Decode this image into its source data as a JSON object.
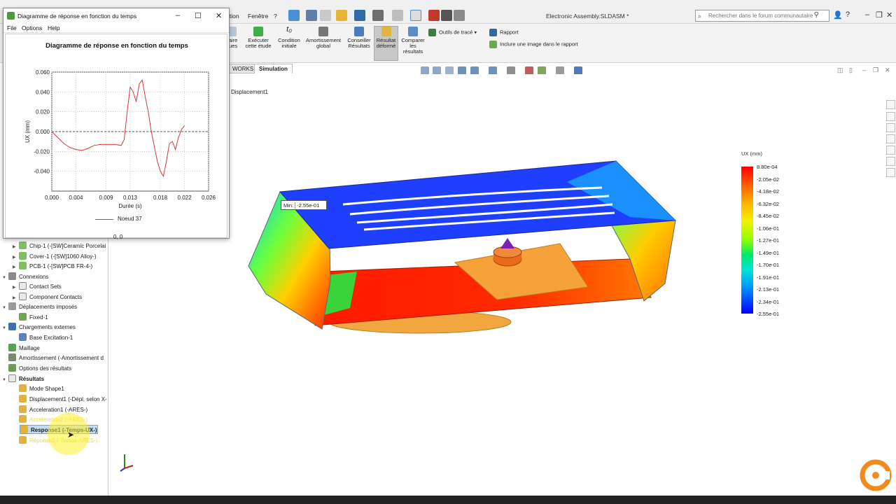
{
  "app": {
    "title": "Electronic Assembly.SLDASM *",
    "menus": [
      "ition",
      "Fenêtre",
      "?"
    ],
    "search_placeholder": "Rechercher dans le forum communautaire"
  },
  "command_manager": {
    "items": [
      {
        "label": "naire ques"
      },
      {
        "label": "Exécuter cette étude"
      },
      {
        "label": "Condition initiale"
      },
      {
        "label": "Amortissement global"
      },
      {
        "label": "Conseiller Résultats"
      },
      {
        "label": "Résultat déformé"
      },
      {
        "label": "Comparer les résultats"
      }
    ],
    "plot_tools": "Outils de tracé",
    "report": "Rapport",
    "include_image": "Inclure une image dans le rapport"
  },
  "tabs": [
    {
      "label": "WORKS"
    },
    {
      "label": "Simulation"
    }
  ],
  "tree": {
    "items": [
      {
        "label": "Chip-1 (-[SW]Ceramic Porcelai",
        "indent": 2
      },
      {
        "label": "Cover-1 (-[SW]1060 Alloy-)",
        "indent": 2
      },
      {
        "label": "PCB-1 (-[SW]PCB FR-4-)",
        "indent": 2
      },
      {
        "label": "Connexions",
        "indent": 1
      },
      {
        "label": "Contact Sets",
        "indent": 2
      },
      {
        "label": "Component Contacts",
        "indent": 2
      },
      {
        "label": "Déplacements imposés",
        "indent": 1
      },
      {
        "label": "Fixed-1",
        "indent": 2
      },
      {
        "label": "Chargements externes",
        "indent": 1
      },
      {
        "label": "Base Excitation-1",
        "indent": 2
      },
      {
        "label": "Maillage",
        "indent": 1
      },
      {
        "label": "Amortissement (-Amortissement d",
        "indent": 1
      },
      {
        "label": "Options des résultats",
        "indent": 1
      },
      {
        "label": "Résultats",
        "indent": 1
      },
      {
        "label": "Mode Shape1",
        "indent": 2
      },
      {
        "label": "Displacement1 (-Dépl. selon X-",
        "indent": 2
      },
      {
        "label": "Acceleration1 (-ARES-)",
        "indent": 2
      },
      {
        "label": "Acceleration2 (-ARES-)",
        "indent": 2
      },
      {
        "label": "Response1 (-Temps-UX-)",
        "indent": 2
      },
      {
        "label": "Réponse2 (-Temps-ARES-)",
        "indent": 2
      }
    ]
  },
  "viewport": {
    "plot_name": "Displacement1",
    "min_label": "Min:",
    "min_value": "-2.55e-01",
    "legend_title": "UX (mm)",
    "legend_labels": [
      "8.80e-04",
      "-2.05e-02",
      "-4.18e-02",
      "-6.32e-02",
      "-8.45e-02",
      "-1.06e-01",
      "-1.27e-01",
      "-1.49e-01",
      "-1.70e-01",
      "-1.91e-01",
      "-2.13e-01",
      "-2.34e-01",
      "-2.55e-01"
    ],
    "legend_top_color": "#ff0000",
    "legend_bottom_color": "#0000ff"
  },
  "dialog": {
    "title": "Diagramme de réponse en fonction du temps",
    "menus": [
      "File",
      "Options",
      "Help"
    ],
    "coord_readout": "0, 0"
  },
  "chart_data": {
    "type": "line",
    "title": "Diagramme de réponse en fonction du temps",
    "xlabel": "Durée (s)",
    "ylabel": "UX (mm)",
    "xlim": [
      0,
      0.026
    ],
    "ylim": [
      -0.06,
      0.06
    ],
    "xticks": [
      "0.000",
      "0.004",
      "0.009",
      "0.013",
      "0.018",
      "0.022",
      "0.026"
    ],
    "yticks": [
      "0.060",
      "0.040",
      "0.020",
      "0.000",
      "-0.020",
      "-0.040"
    ],
    "grid": true,
    "legend": "bottom",
    "series": [
      {
        "name": "Noeud 37",
        "color": "#d23a3a",
        "x": [
          0.0,
          0.001,
          0.002,
          0.003,
          0.004,
          0.005,
          0.006,
          0.007,
          0.008,
          0.009,
          0.0105,
          0.0115,
          0.012,
          0.0125,
          0.013,
          0.0135,
          0.014,
          0.0145,
          0.015,
          0.0155,
          0.016,
          0.0165,
          0.017,
          0.0175,
          0.018,
          0.0185,
          0.019,
          0.0195,
          0.02,
          0.0205,
          0.021,
          0.0215,
          0.022
        ],
        "y": [
          0.0,
          -0.006,
          -0.012,
          -0.016,
          -0.018,
          -0.019,
          -0.017,
          -0.014,
          -0.013,
          -0.013,
          -0.013,
          -0.014,
          -0.008,
          0.02,
          0.045,
          0.04,
          0.03,
          0.048,
          0.052,
          0.035,
          0.02,
          0.0,
          -0.015,
          -0.03,
          -0.04,
          -0.045,
          -0.03,
          -0.012,
          -0.01,
          -0.018,
          -0.006,
          0.002,
          0.006
        ]
      }
    ]
  }
}
